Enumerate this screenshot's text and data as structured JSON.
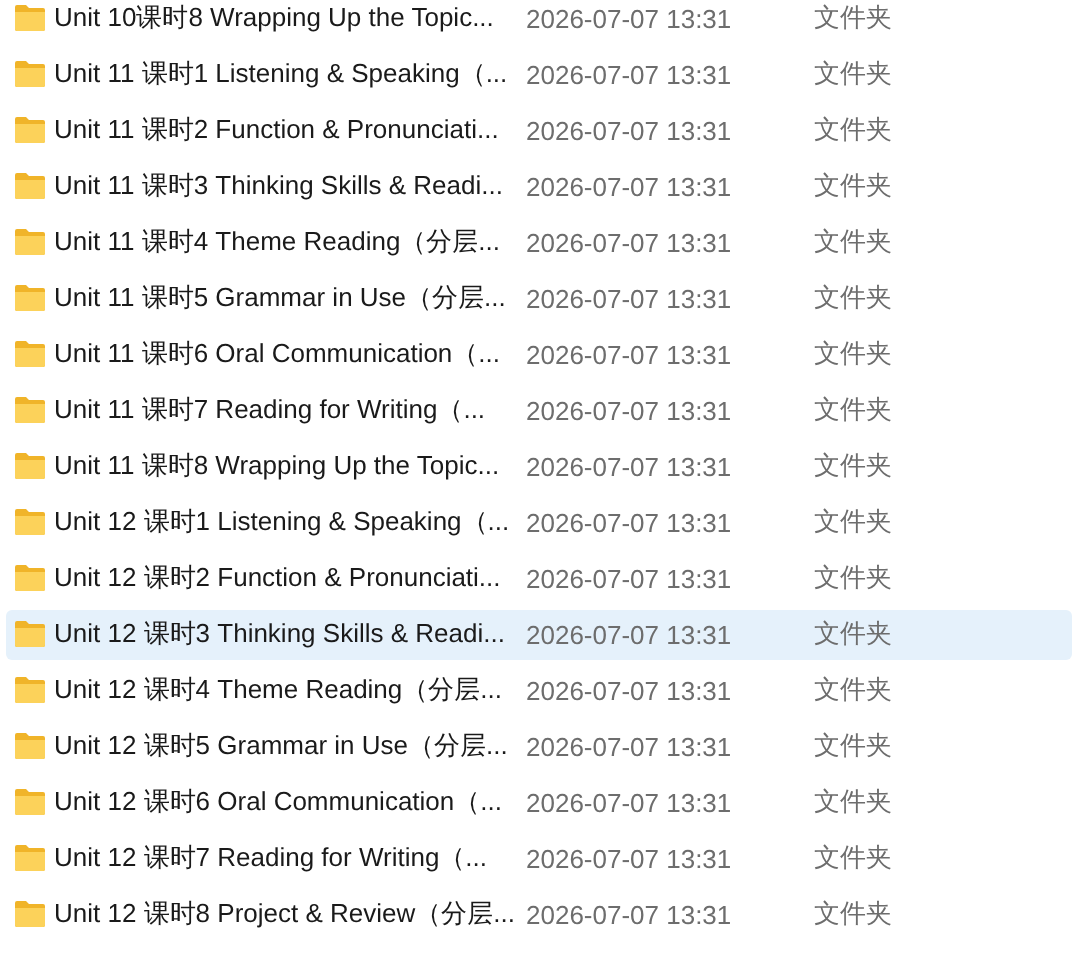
{
  "files": [
    {
      "name": "Unit 10课时8 Wrapping Up the Topic...",
      "modified": "2026-07-07 13:31",
      "type": "文件夹",
      "selected": false
    },
    {
      "name": "Unit 11 课时1 Listening & Speaking（...",
      "modified": "2026-07-07 13:31",
      "type": "文件夹",
      "selected": false
    },
    {
      "name": "Unit 11 课时2 Function & Pronunciati...",
      "modified": "2026-07-07 13:31",
      "type": "文件夹",
      "selected": false
    },
    {
      "name": "Unit 11 课时3 Thinking Skills & Readi...",
      "modified": "2026-07-07 13:31",
      "type": "文件夹",
      "selected": false
    },
    {
      "name": "Unit 11 课时4 Theme Reading（分层...",
      "modified": "2026-07-07 13:31",
      "type": "文件夹",
      "selected": false
    },
    {
      "name": "Unit 11 课时5 Grammar in Use（分层...",
      "modified": "2026-07-07 13:31",
      "type": "文件夹",
      "selected": false
    },
    {
      "name": "Unit 11 课时6 Oral Communication（...",
      "modified": "2026-07-07 13:31",
      "type": "文件夹",
      "selected": false
    },
    {
      "name": "Unit 11 课时7 Reading for Writing（...",
      "modified": "2026-07-07 13:31",
      "type": "文件夹",
      "selected": false
    },
    {
      "name": "Unit 11 课时8 Wrapping Up the Topic...",
      "modified": "2026-07-07 13:31",
      "type": "文件夹",
      "selected": false
    },
    {
      "name": "Unit 12 课时1 Listening & Speaking（...",
      "modified": "2026-07-07 13:31",
      "type": "文件夹",
      "selected": false
    },
    {
      "name": "Unit 12 课时2 Function & Pronunciati...",
      "modified": "2026-07-07 13:31",
      "type": "文件夹",
      "selected": false
    },
    {
      "name": "Unit 12 课时3 Thinking Skills & Readi...",
      "modified": "2026-07-07 13:31",
      "type": "文件夹",
      "selected": true
    },
    {
      "name": "Unit 12 课时4 Theme Reading（分层...",
      "modified": "2026-07-07 13:31",
      "type": "文件夹",
      "selected": false
    },
    {
      "name": "Unit 12 课时5 Grammar in Use（分层...",
      "modified": "2026-07-07 13:31",
      "type": "文件夹",
      "selected": false
    },
    {
      "name": "Unit 12 课时6 Oral Communication（...",
      "modified": "2026-07-07 13:31",
      "type": "文件夹",
      "selected": false
    },
    {
      "name": "Unit 12 课时7 Reading for Writing（...",
      "modified": "2026-07-07 13:31",
      "type": "文件夹",
      "selected": false
    },
    {
      "name": "Unit 12 课时8 Project & Review（分层...",
      "modified": "2026-07-07 13:31",
      "type": "文件夹",
      "selected": false
    }
  ]
}
